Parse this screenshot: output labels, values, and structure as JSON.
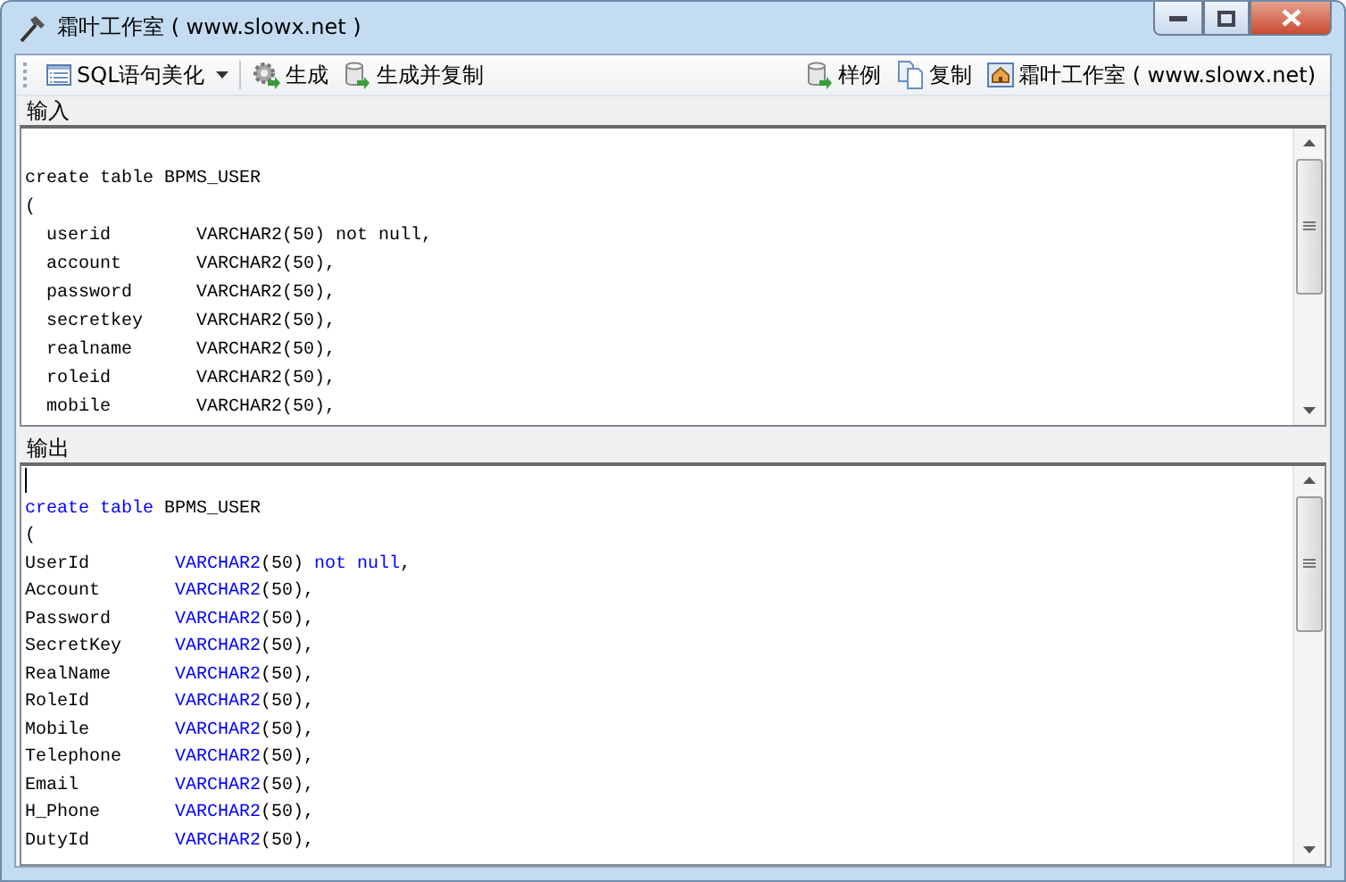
{
  "window": {
    "title": "霜叶工作室 ( www.slowx.net )"
  },
  "toolbar": {
    "left": [
      {
        "label": "SQL语句美化",
        "dropdown": true
      },
      {
        "label": "生成",
        "dropdown": false
      },
      {
        "label": "生成并复制",
        "dropdown": false
      }
    ],
    "right": [
      {
        "label": "样例"
      },
      {
        "label": "复制"
      },
      {
        "label": "霜叶工作室 ( www.slowx.net)"
      }
    ]
  },
  "input": {
    "label": "输入",
    "lines": [
      "create table BPMS_USER",
      "(",
      "  userid        VARCHAR2(50) not null,",
      "  account       VARCHAR2(50),",
      "  password      VARCHAR2(50),",
      "  secretkey     VARCHAR2(50),",
      "  realname      VARCHAR2(50),",
      "  roleid        VARCHAR2(50),",
      "  mobile        VARCHAR2(50),"
    ]
  },
  "output": {
    "label": "输出",
    "lines": [
      [
        {
          "text": "create table",
          "kind": "keyword"
        },
        {
          "text": " BPMS_USER",
          "kind": "plain"
        }
      ],
      [
        {
          "text": "(",
          "kind": "plain"
        }
      ],
      [
        {
          "text": "UserId        ",
          "kind": "plain"
        },
        {
          "text": "VARCHAR2",
          "kind": "keyword"
        },
        {
          "text": "(50) ",
          "kind": "plain"
        },
        {
          "text": "not null",
          "kind": "keyword"
        },
        {
          "text": ",",
          "kind": "plain"
        }
      ],
      [
        {
          "text": "Account       ",
          "kind": "plain"
        },
        {
          "text": "VARCHAR2",
          "kind": "keyword"
        },
        {
          "text": "(50),",
          "kind": "plain"
        }
      ],
      [
        {
          "text": "Password      ",
          "kind": "plain"
        },
        {
          "text": "VARCHAR2",
          "kind": "keyword"
        },
        {
          "text": "(50),",
          "kind": "plain"
        }
      ],
      [
        {
          "text": "SecretKey     ",
          "kind": "plain"
        },
        {
          "text": "VARCHAR2",
          "kind": "keyword"
        },
        {
          "text": "(50),",
          "kind": "plain"
        }
      ],
      [
        {
          "text": "RealName      ",
          "kind": "plain"
        },
        {
          "text": "VARCHAR2",
          "kind": "keyword"
        },
        {
          "text": "(50),",
          "kind": "plain"
        }
      ],
      [
        {
          "text": "RoleId        ",
          "kind": "plain"
        },
        {
          "text": "VARCHAR2",
          "kind": "keyword"
        },
        {
          "text": "(50),",
          "kind": "plain"
        }
      ],
      [
        {
          "text": "Mobile        ",
          "kind": "plain"
        },
        {
          "text": "VARCHAR2",
          "kind": "keyword"
        },
        {
          "text": "(50),",
          "kind": "plain"
        }
      ],
      [
        {
          "text": "Telephone     ",
          "kind": "plain"
        },
        {
          "text": "VARCHAR2",
          "kind": "keyword"
        },
        {
          "text": "(50),",
          "kind": "plain"
        }
      ],
      [
        {
          "text": "Email         ",
          "kind": "plain"
        },
        {
          "text": "VARCHAR2",
          "kind": "keyword"
        },
        {
          "text": "(50),",
          "kind": "plain"
        }
      ],
      [
        {
          "text": "H_Phone       ",
          "kind": "plain"
        },
        {
          "text": "VARCHAR2",
          "kind": "keyword"
        },
        {
          "text": "(50),",
          "kind": "plain"
        }
      ],
      [
        {
          "text": "DutyId        ",
          "kind": "plain"
        },
        {
          "text": "VARCHAR2",
          "kind": "keyword"
        },
        {
          "text": "(50),",
          "kind": "plain"
        }
      ]
    ]
  }
}
